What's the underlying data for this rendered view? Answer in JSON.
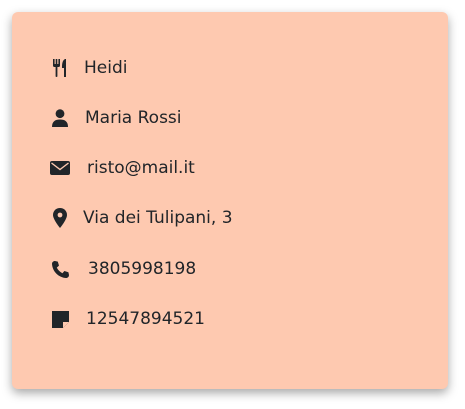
{
  "card": {
    "background": "#fec9b0",
    "items": [
      {
        "icon": "utensils-icon",
        "text": "Heidi"
      },
      {
        "icon": "user-icon",
        "text": "Maria Rossi"
      },
      {
        "icon": "envelope-icon",
        "text": "risto@mail.it"
      },
      {
        "icon": "map-marker-icon",
        "text": "Via dei Tulipani, 3"
      },
      {
        "icon": "phone-icon",
        "text": "3805998198"
      },
      {
        "icon": "sticky-note-icon",
        "text": "12547894521"
      }
    ]
  }
}
